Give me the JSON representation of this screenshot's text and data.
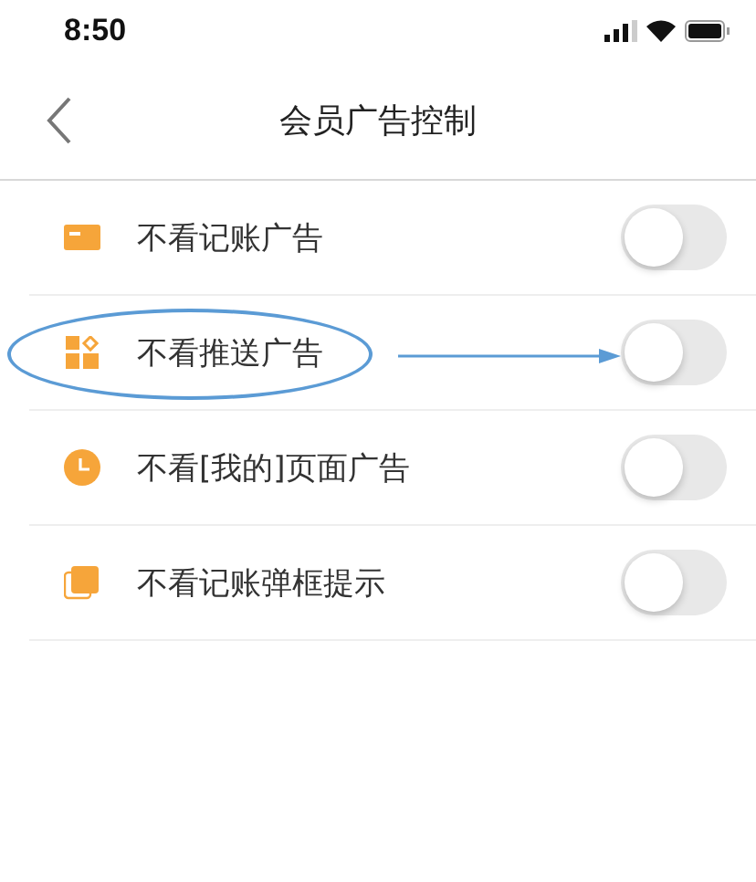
{
  "status_bar": {
    "time": "8:50"
  },
  "nav": {
    "title": "会员广告控制"
  },
  "rows": [
    {
      "label": "不看记账广告",
      "on": false,
      "highlighted": false
    },
    {
      "label": "不看推送广告",
      "on": false,
      "highlighted": true
    },
    {
      "label": "不看[我的]页面广告",
      "on": false,
      "highlighted": false
    },
    {
      "label": "不看记账弹框提示",
      "on": false,
      "highlighted": false
    }
  ]
}
